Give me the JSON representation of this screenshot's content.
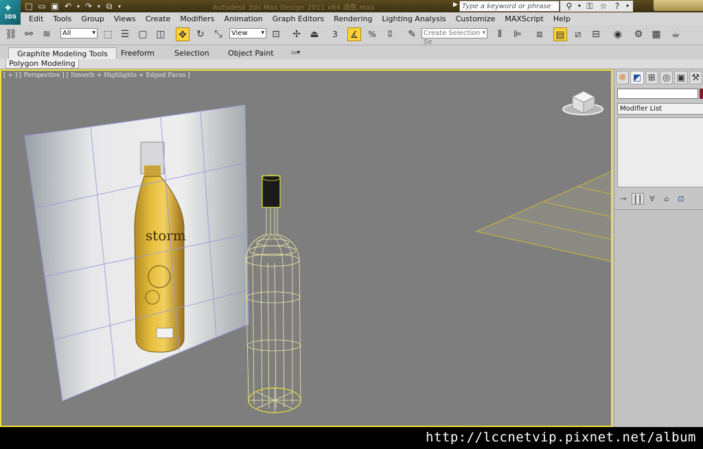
{
  "app": {
    "logo_text": "3DS",
    "window_title": "Autodesk 3ds Max Design 2011 x64    酒瓶.max"
  },
  "quick_access": [
    {
      "name": "new-icon",
      "glyph": "□"
    },
    {
      "name": "open-icon",
      "glyph": "▭"
    },
    {
      "name": "save-icon",
      "glyph": "▣"
    },
    {
      "name": "undo-icon",
      "glyph": "↶"
    },
    {
      "name": "redo-icon",
      "glyph": "↷"
    },
    {
      "name": "project-folder-icon",
      "glyph": "⧉"
    }
  ],
  "search": {
    "placeholder": "Type a keyword or phrase"
  },
  "title_icons": [
    {
      "name": "binoculars-icon",
      "glyph": "⚲"
    },
    {
      "name": "key-icon",
      "glyph": "⚿"
    },
    {
      "name": "star-icon",
      "glyph": "☆"
    },
    {
      "name": "help-icon",
      "glyph": "?"
    }
  ],
  "menu": [
    "Edit",
    "Tools",
    "Group",
    "Views",
    "Create",
    "Modifiers",
    "Animation",
    "Graph Editors",
    "Rendering",
    "Lighting Analysis",
    "Customize",
    "MAXScript",
    "Help"
  ],
  "toolbar": {
    "selection_filter": "All",
    "reference_coord": "View",
    "named_selection_placeholder": "Create Selection Se",
    "snap_label": "3",
    "percent_label": "%"
  },
  "ribbon": {
    "tabs": [
      "Graphite Modeling Tools",
      "Freeform",
      "Selection",
      "Object Paint"
    ],
    "active_tab": 0,
    "panel_tab": "Polygon Modeling"
  },
  "viewport": {
    "label": "[ + ] [ Perspective ] [ Smooth + Highlights + Edged Faces ]",
    "reference_photo_text": "storm"
  },
  "command_panel": {
    "modifier_list_label": "Modifier List",
    "swatch_color": "#8a1a2a"
  },
  "colors": {
    "active_border": "#f0e438",
    "viewport_bg": "#7e7e7e",
    "wire_color": "#f4f0a8",
    "grid_color": "#c8b040"
  },
  "watermark": "http://lccnetvip.pixnet.net/album"
}
